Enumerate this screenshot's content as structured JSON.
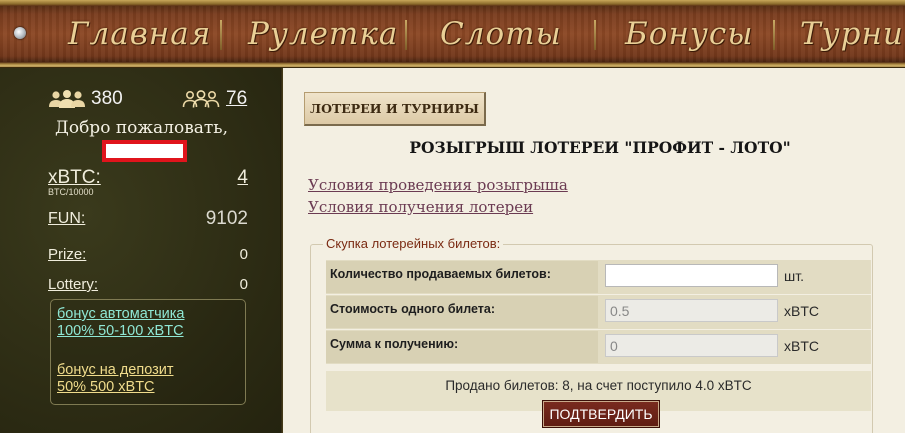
{
  "nav": {
    "items": [
      "Главная",
      "Рулетка",
      "Слоты",
      "Бонусы",
      "Турниры"
    ]
  },
  "sidebar": {
    "online_icon": "users-icon",
    "online_count": "380",
    "friends_icon": "users-outline-icon",
    "friends_count": "76",
    "welcome": "Добро пожаловать,",
    "balances": [
      {
        "label": "xBTC:",
        "sub": "BTC/10000",
        "value": "4"
      },
      {
        "label": "FUN:",
        "value": "9102"
      },
      {
        "label": "Prize:",
        "value": "0"
      },
      {
        "label": "Lottery:",
        "value": "0"
      }
    ],
    "bonuses": [
      {
        "line1": "бонус автоматчика",
        "line2": "100% 50-100 xBTC"
      },
      {
        "line1": "бонус на депозит",
        "line2": "50% 500 xBTC"
      }
    ]
  },
  "main": {
    "section_tab": "ЛОТЕРЕИ И ТУРНИРЫ",
    "title": "РОЗЫГРЫШ ЛОТЕРЕИ \"ПРОФИТ - ЛОТО\"",
    "links": [
      "Условия проведения розыгрыша",
      "Условия получения лотереи"
    ],
    "form": {
      "legend": "Скупка лотерейных билетов:",
      "rows": [
        {
          "label": "Количество продаваемых билетов:",
          "value": "",
          "unit": "шт."
        },
        {
          "label": "Стоимость одного билета:",
          "value": "0.5",
          "unit": "xBTC"
        },
        {
          "label": "Сумма к получению:",
          "value": "0",
          "unit": "xBTC"
        }
      ],
      "sold_text": "Продано билетов: 8, на счет поступило 4.0 xBTC",
      "submit_label": "ПОДТВЕРДИТЬ"
    }
  },
  "colors": {
    "nav_text": "#e9cf96",
    "sidebar_bg": "#2d2c14",
    "main_bg": "#f3efe2",
    "button_bg": "#6e2418",
    "link": "#6b3b52",
    "bonus_link": "#8fe7d4",
    "username_border": "#e0141c"
  }
}
